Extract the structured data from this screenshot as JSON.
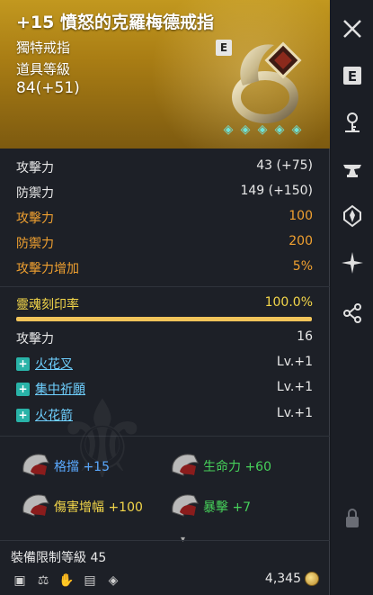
{
  "header": {
    "title": "+15 憤怒的克羅梅德戒指",
    "type": "獨特戒指",
    "item_level_label": "道具等級",
    "item_level_value": "84(+51)",
    "badge": "E",
    "gems": [
      "gem-icon",
      "gem-icon",
      "gem-icon",
      "gem-icon",
      "gem-icon"
    ]
  },
  "stats": [
    {
      "label": "攻擊力",
      "value": "43 (+75)",
      "color": "white"
    },
    {
      "label": "防禦力",
      "value": "149 (+150)",
      "color": "white"
    },
    {
      "label": "攻擊力",
      "value": "100",
      "color": "orange"
    },
    {
      "label": "防禦力",
      "value": "200",
      "color": "orange"
    },
    {
      "label": "攻擊力增加",
      "value": "5%",
      "color": "orange"
    }
  ],
  "soul": {
    "label": "靈魂刻印率",
    "value": "100.0%",
    "progress": 1.0
  },
  "attack_line": {
    "label": "攻擊力",
    "value": "16"
  },
  "skills": [
    {
      "name": "火花叉",
      "level": "Lv.+1"
    },
    {
      "name": "集中祈願",
      "level": "Lv.+1"
    },
    {
      "name": "火花箭",
      "level": "Lv.+1"
    }
  ],
  "enchants": [
    {
      "name": "格擋",
      "value": "+15",
      "color": "#5aa9ff"
    },
    {
      "name": "生命力",
      "value": "+60",
      "color": "#46d15a"
    },
    {
      "name": "傷害增幅",
      "value": "+100",
      "color": "#f3d64a"
    },
    {
      "name": "暴擊",
      "value": "+7",
      "color": "#46d15a"
    }
  ],
  "footer": {
    "limit_label": "裝備限制等級 45",
    "price": "4,345",
    "icons": [
      "box-icon",
      "scale-icon",
      "hand-icon",
      "book-icon",
      "diamond-icon"
    ]
  },
  "sidebar": [
    "close-icon",
    "e-icon",
    "key-icon",
    "anvil-icon",
    "sword-icon",
    "sparkle-icon",
    "share-icon",
    "lock-icon"
  ]
}
